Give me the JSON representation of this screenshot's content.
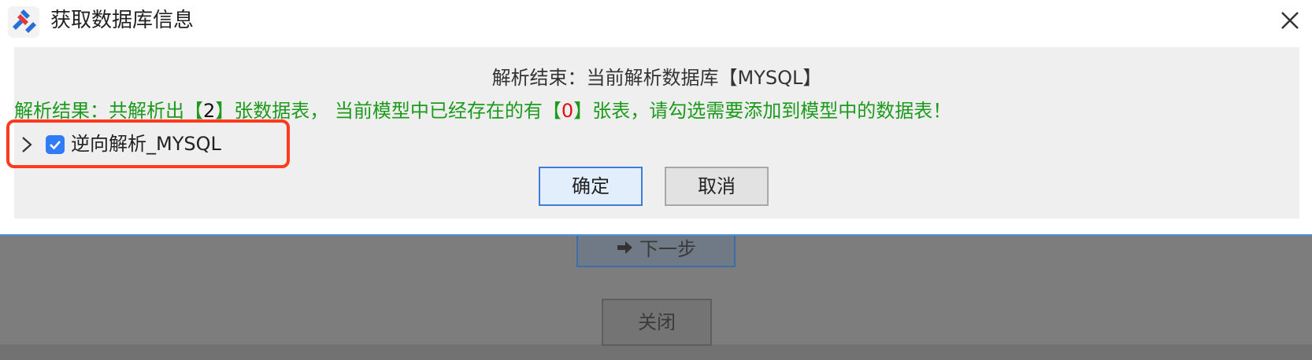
{
  "dialog": {
    "title": "获取数据库信息",
    "status_line": "解析结束：当前解析数据库【MYSQL】",
    "result": {
      "prefix": "解析结果：共解析出【",
      "table_count": "2",
      "middle": "】张数据表， 当前模型中已经存在的有【",
      "existing_count": "0",
      "suffix": "】张表，请勾选需要添加到模型中的数据表！"
    },
    "tree": {
      "items": [
        {
          "label": "逆向解析_MYSQL",
          "checked": true,
          "expanded": false
        }
      ]
    },
    "buttons": {
      "ok": "确定",
      "cancel": "取消"
    }
  },
  "background": {
    "next_button": "下一步",
    "close_button": "关闭"
  },
  "colors": {
    "result_text": "#1c9a1c",
    "zero_count": "#e01010",
    "checkbox": "#2f7cf6",
    "highlight": "#ff3b1f"
  },
  "icons": [
    "app-logo-icon",
    "close-icon",
    "chevron-right-icon",
    "checkmark-icon",
    "arrow-right-icon"
  ]
}
